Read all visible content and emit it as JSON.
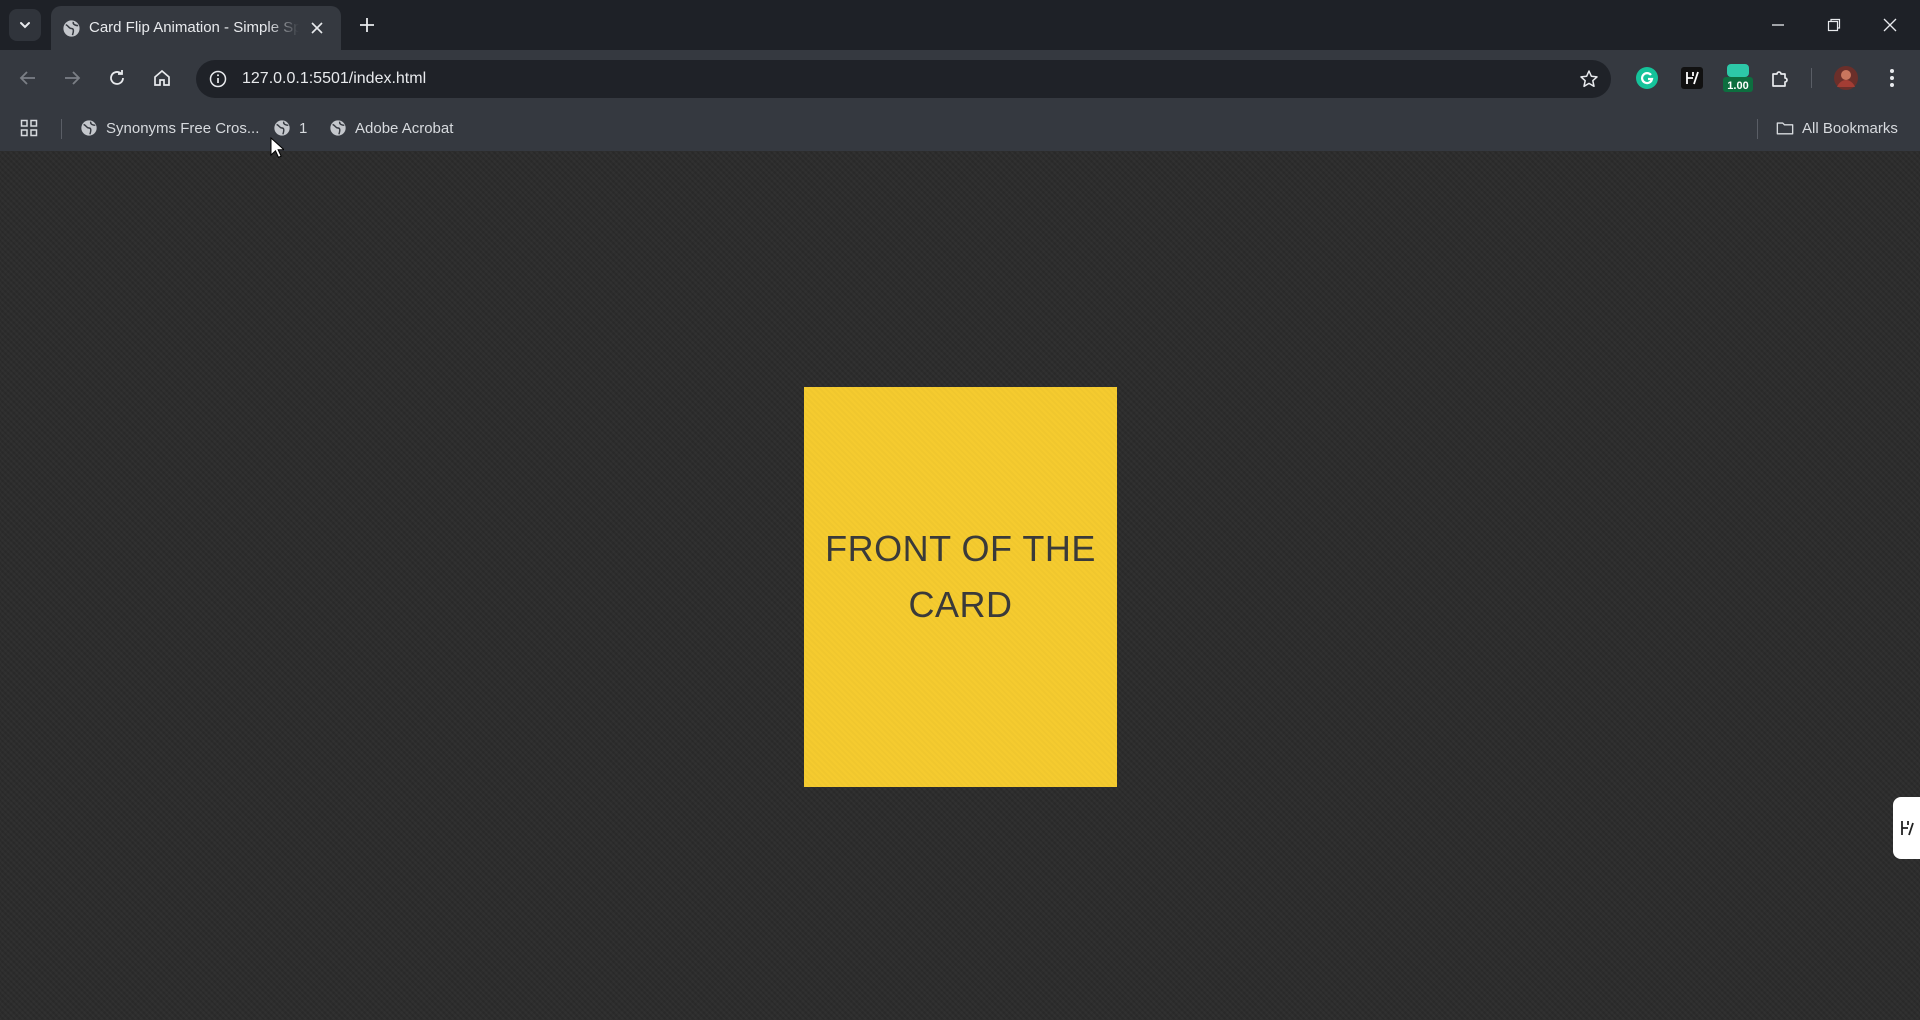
{
  "tabs": [
    {
      "title": "Card Flip Animation - Simple Sp",
      "active": true
    }
  ],
  "omnibox": {
    "url": "127.0.0.1:5501/index.html"
  },
  "extensions": {
    "speed_badge": "1.00"
  },
  "bookmarks": {
    "items": [
      {
        "label": "Synonyms Free Cros...",
        "icon": "globe-icon"
      },
      {
        "label": "1",
        "icon": "globe-icon"
      },
      {
        "label": "Adobe Acrobat",
        "icon": "globe-icon"
      }
    ],
    "all_bookmarks": "All Bookmarks"
  },
  "card": {
    "front_text": "FRONT OF THE CARD",
    "color": "#f5cb2f"
  },
  "colors": {
    "page_bg": "#2c2c2c",
    "chrome_dark": "#1e2127",
    "chrome": "#353940",
    "accent_green": "#1fa463"
  }
}
